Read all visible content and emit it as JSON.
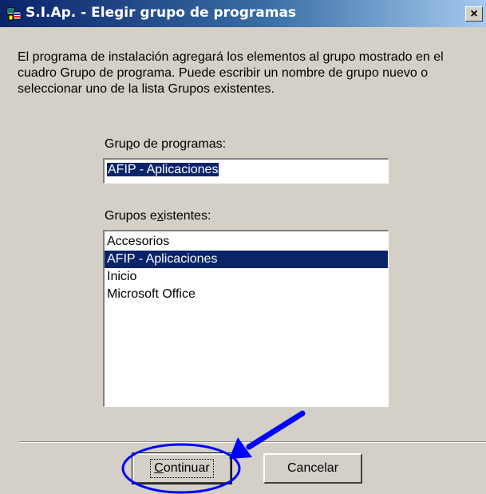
{
  "window": {
    "title": "S.I.Ap. - Elegir grupo de programas",
    "close_symbol": "×"
  },
  "description": "El programa de instalación agregará los elementos al grupo mostrado en el cuadro Grupo de programa. Puede escribir un nombre de grupo nuevo o seleccionar uno de la lista Grupos existentes.",
  "program_group": {
    "label_pre": "Gru",
    "label_mnemonic": "p",
    "label_post": "o de programas:",
    "value": "AFIP - Aplicaciones"
  },
  "existing_groups": {
    "label_pre": "Grupos e",
    "label_mnemonic": "x",
    "label_post": "istentes:",
    "items": [
      "Accesorios",
      "AFIP - Aplicaciones",
      "Inicio",
      "Microsoft Office"
    ],
    "selected_index": 1
  },
  "buttons": {
    "continue_mnemonic": "C",
    "continue_rest": "ontinuar",
    "cancel": "Cancelar"
  },
  "annotation": {
    "color": "#0000ff",
    "icons": [
      "arrow-annotation-icon",
      "ellipse-annotation-icon"
    ]
  }
}
